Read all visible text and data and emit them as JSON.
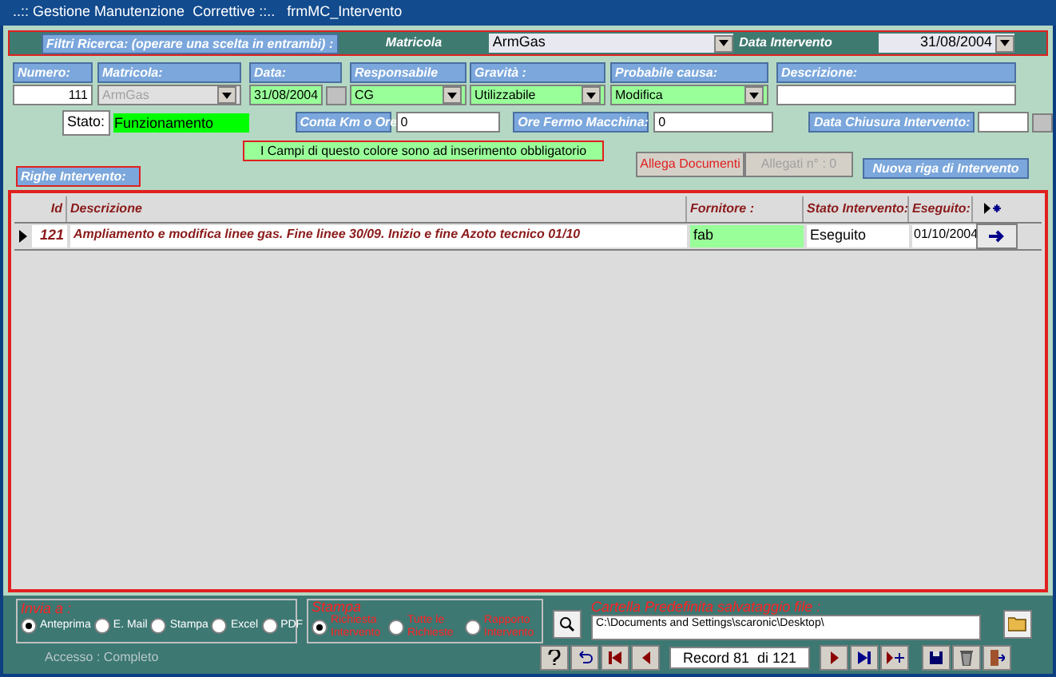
{
  "window": {
    "title": "..:: Gestione Manutenzione  Correttive ::..   frmMC_Intervento"
  },
  "filters": {
    "label": "Filtri Ricerca:  (operare una scelta in  entrambi) :",
    "matricola_label": "Matricola",
    "matricola_value": "ArmGas",
    "data_label": "Data Intervento",
    "data_value": "31/08/2004"
  },
  "fields": [
    {
      "label": "Numero:",
      "value": "111",
      "kind": "text",
      "required": false,
      "disabled": false
    },
    {
      "label": "Matricola:",
      "value": "ArmGas",
      "kind": "combo",
      "required": false,
      "disabled": true
    },
    {
      "label": "Data:",
      "value": "31/08/2004",
      "kind": "date",
      "required": true,
      "disabled": false
    },
    {
      "label": "Responsabile",
      "value": "CG",
      "kind": "combo",
      "required": true,
      "disabled": false
    },
    {
      "label": "Gravità :",
      "value": "Utilizzabile",
      "kind": "combo",
      "required": true,
      "disabled": false
    },
    {
      "label": "Probabile causa:",
      "value": "Modifica",
      "kind": "combo",
      "required": true,
      "disabled": false
    },
    {
      "label": "Descrizione:",
      "kind": "text",
      "required": false,
      "disabled": false
    }
  ],
  "stato": {
    "label": "Stato:",
    "value": "Funzionamento"
  },
  "conta": {
    "label": "Conta Km o Ore",
    "value": "0"
  },
  "ore_fermo": {
    "label": "Ore Fermo Macchina:",
    "value": "0"
  },
  "data_chiusura": {
    "label": "Data Chiusura Intervento:"
  },
  "notice": "I Campi di questo colore sono ad inserimento obbligatorio",
  "buttons": [
    {
      "label": "Allega Documenti",
      "disabled": false
    },
    {
      "label": "Allegati n° : 0",
      "disabled": true
    }
  ],
  "new_row_button": "Nuova riga di Intervento",
  "righe_label": "Righe Intervento:",
  "table": {
    "columns": [
      "Id",
      "Descrizione",
      "Fornitore :",
      "Stato Intervento:",
      "Eseguito:"
    ],
    "rows": [
      {
        "id": "121",
        "descrizione": "Ampliamento e modifica linee gas. Fine linee 30/09. Inizio e fine Azoto tecnico 01/10",
        "fornitore": "fab",
        "stato": "Eseguito",
        "eseguito": "01/10/2004",
        "selected": true
      }
    ]
  },
  "invia": {
    "title": "Invia a :",
    "options": [
      {
        "label": "Anteprima",
        "selected": true
      },
      {
        "label": "E. Mail",
        "selected": false
      },
      {
        "label": "Stampa",
        "selected": false
      },
      {
        "label": "Excel",
        "selected": false
      },
      {
        "label": "PDF",
        "selected": false
      }
    ]
  },
  "stampa": {
    "title": "Stampa",
    "options": [
      {
        "label": "Richiesta Intervento",
        "selected": true
      },
      {
        "label": "Tutte le Richieste",
        "selected": false
      },
      {
        "label": "Rapporto Intervento",
        "selected": false
      }
    ]
  },
  "folder": {
    "label": "Cartella Predefinita salvataggio file :",
    "value": "C:\\Documents and Settings\\scaronic\\Desktop\\"
  },
  "access": "Accesso : Completo",
  "record": "Record 81  di 121"
}
